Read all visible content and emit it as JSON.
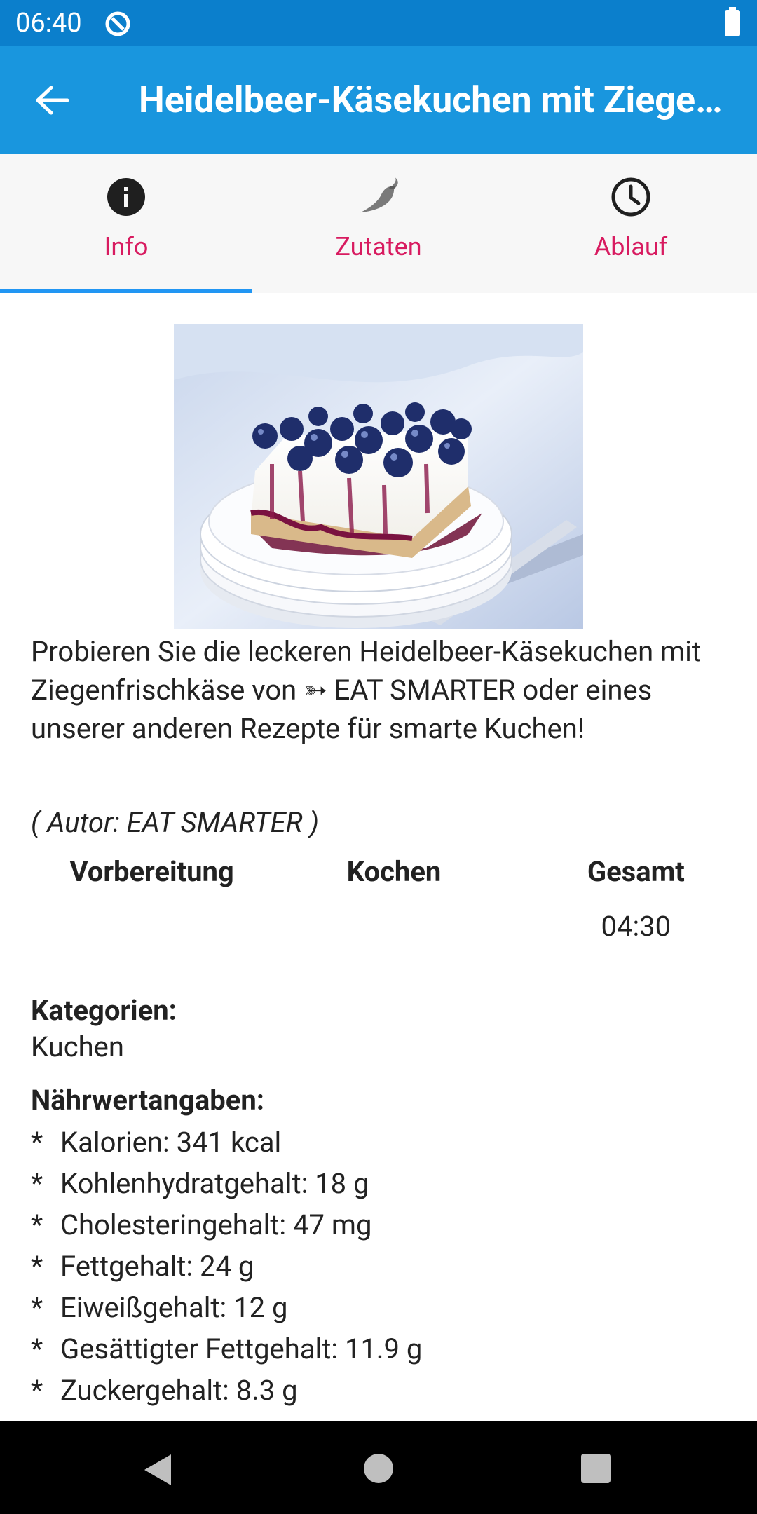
{
  "status_bar": {
    "time": "06:40",
    "icons": [
      "data-saver-icon",
      "battery-icon"
    ]
  },
  "app_bar": {
    "title": "Heidelbeer-Käsekuchen mit Ziegenfrischkäse"
  },
  "tabs": [
    {
      "label": "Info",
      "icon": "info-icon",
      "selected": true
    },
    {
      "label": "Zutaten",
      "icon": "chili-icon",
      "selected": false
    },
    {
      "label": "Ablauf",
      "icon": "clock-icon",
      "selected": false
    }
  ],
  "recipe": {
    "image_alt": "Blueberry cheesecake on white plates",
    "description_before": "Probieren Sie die leckeren Heidelbeer-Käsekuchen mit Ziegenfrischkäse von ",
    "source_link": "➳ EAT SMARTER",
    "description_after": " oder eines unserer anderen Rezepte für smarte Kuchen!",
    "author": "( Autor: EAT SMARTER )",
    "times": {
      "headers": [
        "Vorbereitung",
        "Kochen",
        "Gesamt"
      ],
      "values": [
        "",
        "",
        "04:30"
      ]
    },
    "categories_label": "Kategorien:",
    "categories_value": "Kuchen",
    "nutrition_label": "Nährwertangaben:",
    "nutrition_bullet": "*",
    "nutrition": [
      "Kalorien: 341 kcal",
      "Kohlenhydratgehalt: 18 g",
      "Cholesteringehalt: 47 mg",
      "Fettgehalt: 24 g",
      "Eiweißgehalt: 12 g",
      "Gesättigter Fettgehalt: 11.9 g",
      "Zuckergehalt: 8.3 g"
    ]
  },
  "colors": {
    "status_bar": "#0b7fcc",
    "app_bar": "#1996de",
    "tab_label": "#d81b60",
    "tab_indicator": "#2196f3"
  }
}
